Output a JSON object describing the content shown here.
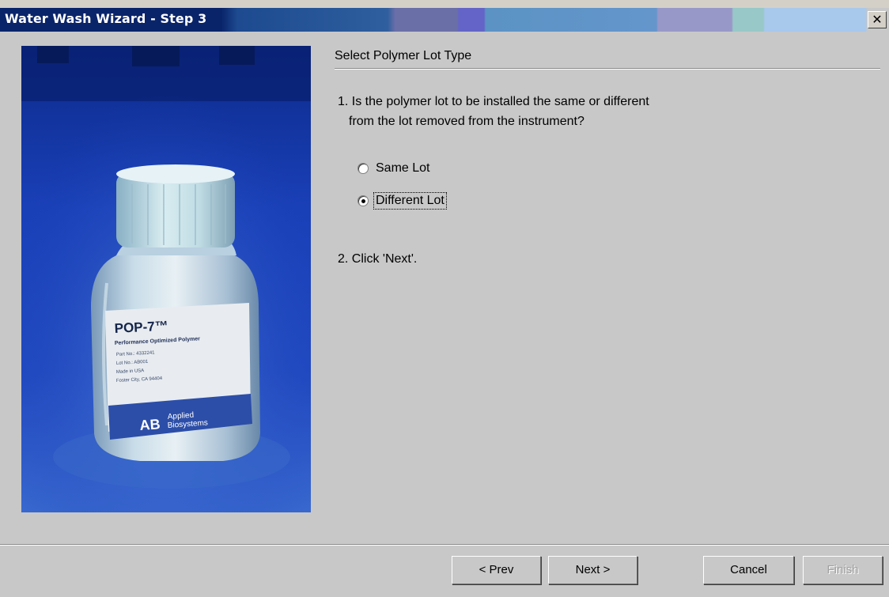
{
  "window": {
    "title": "Water Wash Wizard - Step 3",
    "close_glyph": "✕"
  },
  "image": {
    "label_title": "POP-7™",
    "label_subtitle": "Performance Optimized Polymer",
    "label_lines": [
      "Part No.: 4332241",
      "Lot No.: AB001",
      "Made in USA",
      "Foster City, CA 94404"
    ],
    "brand_logo_text": "AB",
    "brand_name_line1": "Applied",
    "brand_name_line2": "Biosystems"
  },
  "content": {
    "heading": "Select Polymer Lot Type",
    "step1_line1": "1. Is the polymer lot to be installed the same or different",
    "step1_line2": "from the lot removed from the instrument?",
    "options": [
      {
        "label": "Same Lot",
        "selected": false
      },
      {
        "label": "Different Lot",
        "selected": true
      }
    ],
    "step2": "2. Click 'Next'."
  },
  "buttons": {
    "prev": "< Prev",
    "next": "Next >",
    "cancel": "Cancel",
    "finish": "Finish",
    "finish_enabled": false
  }
}
